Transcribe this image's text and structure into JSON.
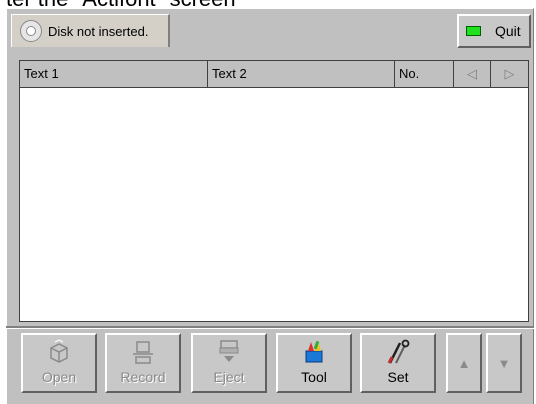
{
  "caption": "ter the \"Actifont\" screen",
  "tab": {
    "label": "Disk not inserted."
  },
  "quit": {
    "label": "Quit"
  },
  "list": {
    "columns": [
      "Text 1",
      "Text 2",
      "No."
    ],
    "prev_arrow": "◁",
    "next_arrow": "▷"
  },
  "toolbar": {
    "open": "Open",
    "record": "Record",
    "eject": "Eject",
    "tool": "Tool",
    "set": "Set",
    "up": "▲",
    "down": "▼"
  },
  "colors": {
    "led": "#20e020",
    "panel": "#c0c0c0"
  }
}
